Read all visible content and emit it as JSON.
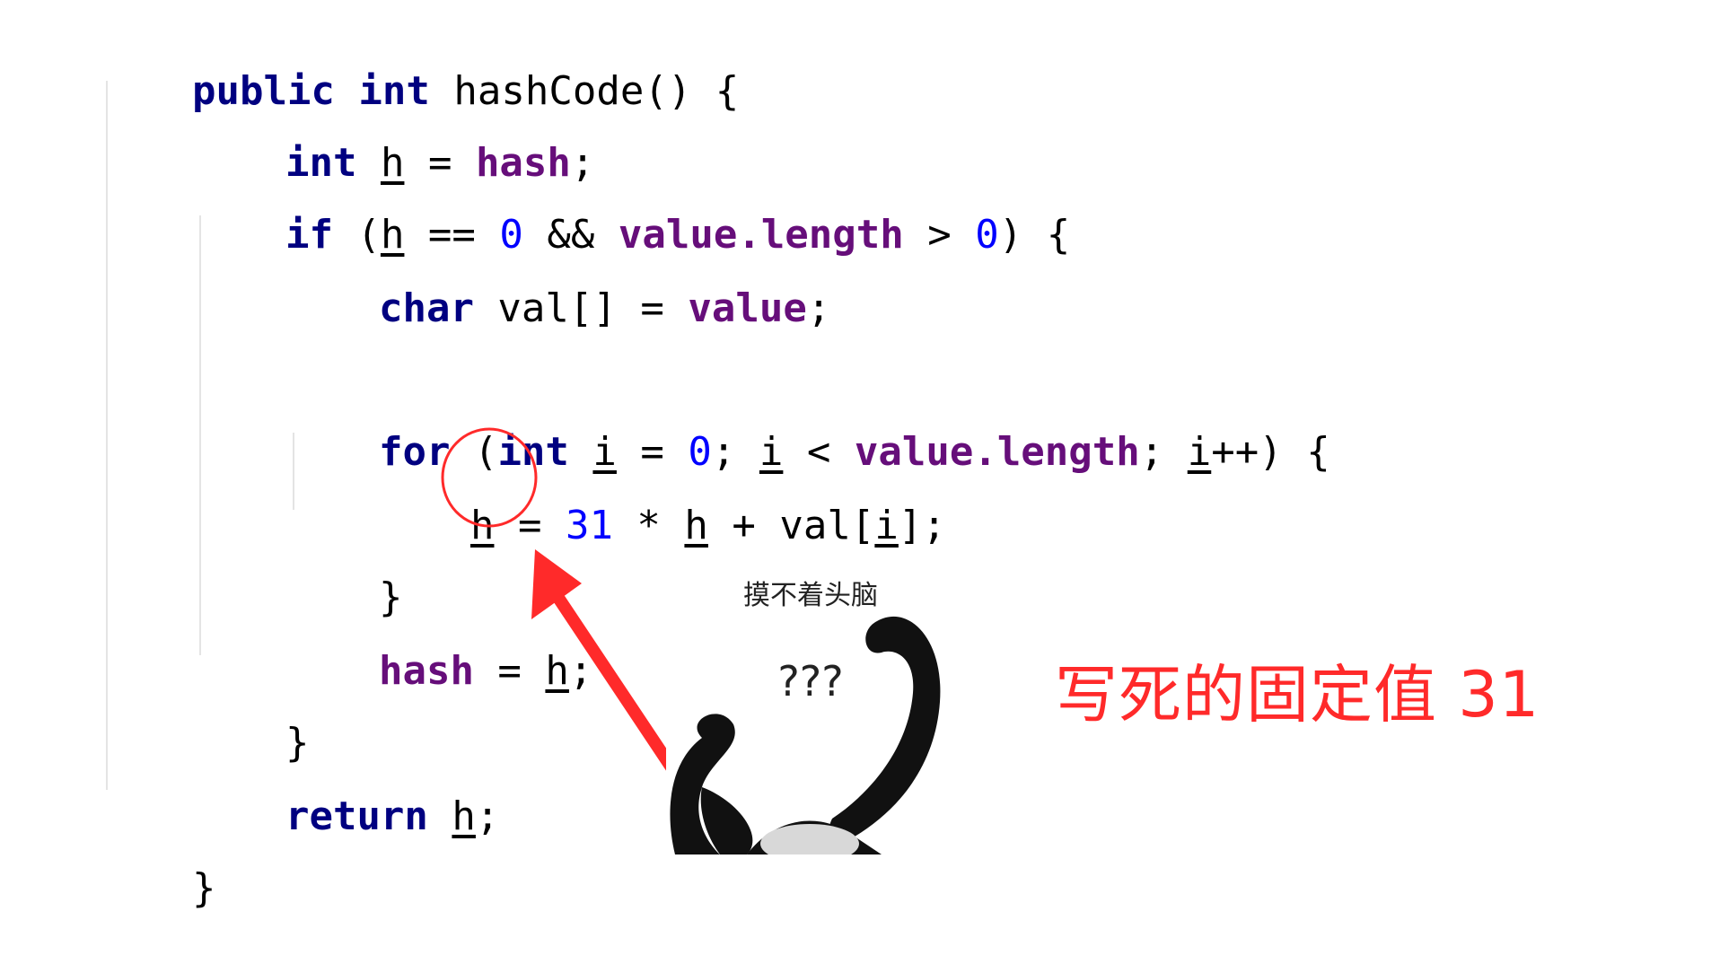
{
  "code": {
    "line1": {
      "kw1": "public",
      "kw2": "int",
      "rest": "hashCode() {"
    },
    "line2": {
      "kw": "int",
      "var": "h",
      "eq": " = ",
      "field": "hash",
      "semi": ";"
    },
    "line3": {
      "kw": "if",
      "p1": " (",
      "var": "h",
      "mid": " == ",
      "zero": "0",
      "amp": " && ",
      "field": "value.length",
      "gt": " > ",
      "zero2": "0",
      "end": ") {"
    },
    "line4": {
      "kw": "char",
      "mid": " val[] = ",
      "field": "value",
      "semi": ";"
    },
    "line5": {
      "kw1": "for",
      "p1": " (",
      "kw2": "int",
      "sp": " ",
      "var": "i",
      "eq": " = ",
      "zero": "0",
      "semi": "; ",
      "var2": "i",
      "lt": " < ",
      "field": "value.length",
      "semi2": "; ",
      "var3": "i",
      "end": "++) {"
    },
    "line6": {
      "var": "h",
      "eq": " = ",
      "num": "31",
      "mul": " * ",
      "var2": "h",
      "plus": " + val[",
      "var3": "i",
      "end": "];"
    },
    "line7": {
      "text": "}"
    },
    "line8": {
      "field": "hash",
      "eq": " = ",
      "var": "h",
      "semi": ";"
    },
    "line9": {
      "text": "}"
    },
    "line10": {
      "kw": "return",
      "sp": " ",
      "var": "h",
      "semi": ";"
    },
    "line11": {
      "text": "}"
    }
  },
  "annotation": {
    "text": "写死的固定值 31",
    "color": "#ff2a2a"
  },
  "meme": {
    "caption": "摸不着头脑",
    "question": "???"
  },
  "colors": {
    "keyword": "#000080",
    "field": "#660e7a",
    "number": "#0000ff",
    "highlight": "#ff2a2a"
  }
}
